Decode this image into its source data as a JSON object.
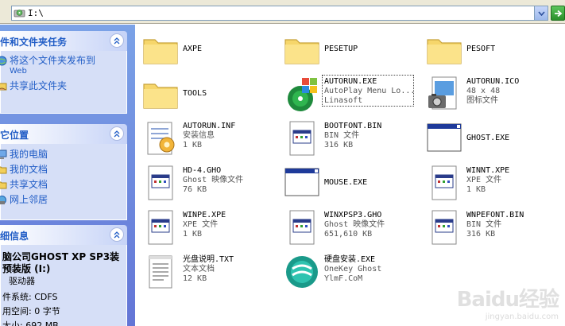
{
  "address_bar": {
    "path": "I:\\"
  },
  "task_pane": {
    "file_tasks": {
      "title": "件和文件夹任务",
      "items": [
        {
          "label": "将这个文件夹发布到",
          "sub": "Web",
          "icon": "globe-icon"
        },
        {
          "label": "共享此文件夹",
          "sub": "",
          "icon": "share-hand-icon"
        }
      ]
    },
    "other_places": {
      "title": "它位置",
      "items": [
        {
          "label": "我的电脑",
          "icon": "computer-icon"
        },
        {
          "label": "我的文档",
          "icon": "folder-icon"
        },
        {
          "label": "共享文档",
          "icon": "folder-icon"
        },
        {
          "label": "网上邻居",
          "icon": "network-icon"
        }
      ]
    },
    "details": {
      "title": "细信息",
      "drive_title_1": "脑公司GHOST XP SP3装",
      "drive_title_2": "预装版 (I:)",
      "drive_type": "驱动器",
      "filesystem": "件系统: CDFS",
      "free_space": "用空间: 0 字节",
      "total_size": "大小: 692 MB"
    }
  },
  "files": [
    {
      "name": "AXPE",
      "line2": "",
      "line3": "",
      "icon": "folder-icon"
    },
    {
      "name": "PESETUP",
      "line2": "",
      "line3": "",
      "icon": "folder-icon"
    },
    {
      "name": "PESOFT",
      "line2": "",
      "line3": "",
      "icon": "folder-icon"
    },
    {
      "name": "TOOLS",
      "line2": "",
      "line3": "",
      "icon": "folder-icon"
    },
    {
      "name": "AUTORUN.EXE",
      "line2": "AutoPlay Menu Lo...",
      "line3": "Linasoft",
      "icon": "autoplay-app-icon"
    },
    {
      "name": "AUTORUN.ICO",
      "line2": "48 x 48",
      "line3": "图标文件",
      "icon": "image-file-icon"
    },
    {
      "name": "AUTORUN.INF",
      "line2": "安装信息",
      "line3": "1 KB",
      "icon": "setup-info-icon"
    },
    {
      "name": "BOOTFONT.BIN",
      "line2": "BIN 文件",
      "line3": "316 KB",
      "icon": "generic-file-icon"
    },
    {
      "name": "GHOST.EXE",
      "line2": "",
      "line3": "",
      "icon": "window-app-icon"
    },
    {
      "name": "HD-4.GHO",
      "line2": "Ghost 映像文件",
      "line3": "76 KB",
      "icon": "generic-file-icon"
    },
    {
      "name": "MOUSE.EXE",
      "line2": "",
      "line3": "",
      "icon": "window-app-icon"
    },
    {
      "name": "WINNT.XPE",
      "line2": "XPE 文件",
      "line3": "1 KB",
      "icon": "generic-file-icon"
    },
    {
      "name": "WINPE.XPE",
      "line2": "XPE 文件",
      "line3": "1 KB",
      "icon": "generic-file-icon"
    },
    {
      "name": "WINXPSP3.GHO",
      "line2": "Ghost 映像文件",
      "line3": "651,610 KB",
      "icon": "generic-file-icon"
    },
    {
      "name": "WNPEFONT.BIN",
      "line2": "BIN 文件",
      "line3": "316 KB",
      "icon": "generic-file-icon"
    },
    {
      "name": "光盘说明.TXT",
      "line2": "文本文档",
      "line3": "12 KB",
      "icon": "text-file-icon"
    },
    {
      "name": "硬盘安装.EXE",
      "line2": "OneKey Ghost",
      "line3": "YlmF.CoM",
      "icon": "onekey-ghost-icon"
    }
  ],
  "watermark": {
    "logo": "Baidu经验",
    "url": "jingyan.baidu.com"
  },
  "colors": {
    "pane_gradient_top": "#7ba2e7",
    "pane_gradient_bottom": "#6375d6",
    "pane_body": "#d6dff7",
    "link_blue": "#215dc6",
    "folder_yellow": "#f6d66b"
  }
}
